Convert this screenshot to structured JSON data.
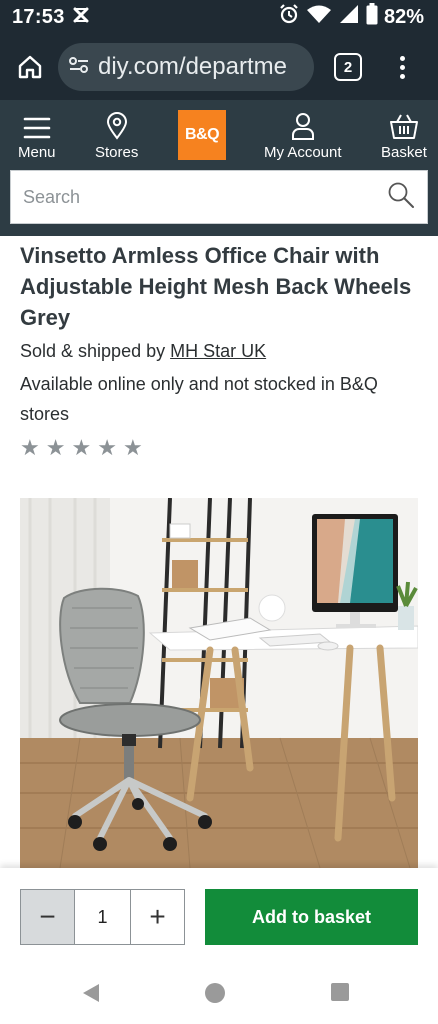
{
  "status_bar": {
    "time": "17:53",
    "battery": "82%"
  },
  "browser": {
    "url": "diy.com/departme",
    "tab_count": "2"
  },
  "header": {
    "logo_text": "B&Q",
    "brand_color": "#f6821f",
    "nav": {
      "menu": "Menu",
      "stores": "Stores",
      "account": "My Account",
      "basket": "Basket"
    },
    "search": {
      "placeholder": "Search"
    }
  },
  "product": {
    "title": "Vinsetto Armless Office Chair with Adjustable Height Mesh Back Wheels Grey",
    "sold_prefix": "Sold & shipped by ",
    "seller": "MH Star UK",
    "availability": "Available online only and not stocked in B&Q stores",
    "rating": {
      "stars_filled": 0,
      "stars_total": 5
    }
  },
  "buy_bar": {
    "quantity": "1",
    "minus_label": "−",
    "plus_label": "+",
    "add_label": "Add to basket",
    "add_color": "#128c3a"
  }
}
